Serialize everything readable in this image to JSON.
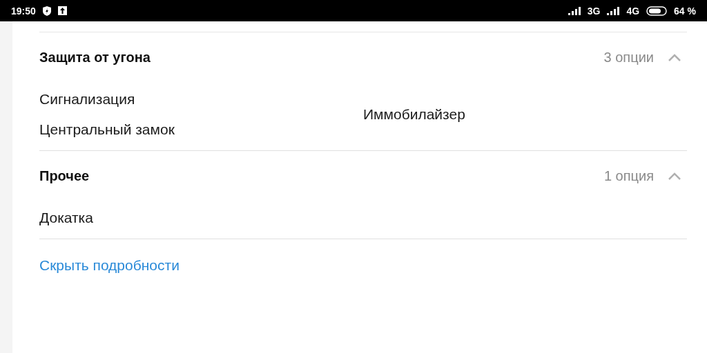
{
  "status_bar": {
    "time": "19:50",
    "network_1": "3G",
    "network_2": "4G",
    "battery_level": "64 %"
  },
  "sections": [
    {
      "title": "Защита от угона",
      "count": "3 опции",
      "expanded": true,
      "columns": [
        [
          "Сигнализация",
          "Центральный замок"
        ],
        [
          "Иммобилайзер"
        ]
      ]
    },
    {
      "title": "Прочее",
      "count": "1 опция",
      "expanded": true,
      "columns": [
        [
          "Докатка"
        ]
      ]
    }
  ],
  "toggle_link": "Скрыть подробности"
}
